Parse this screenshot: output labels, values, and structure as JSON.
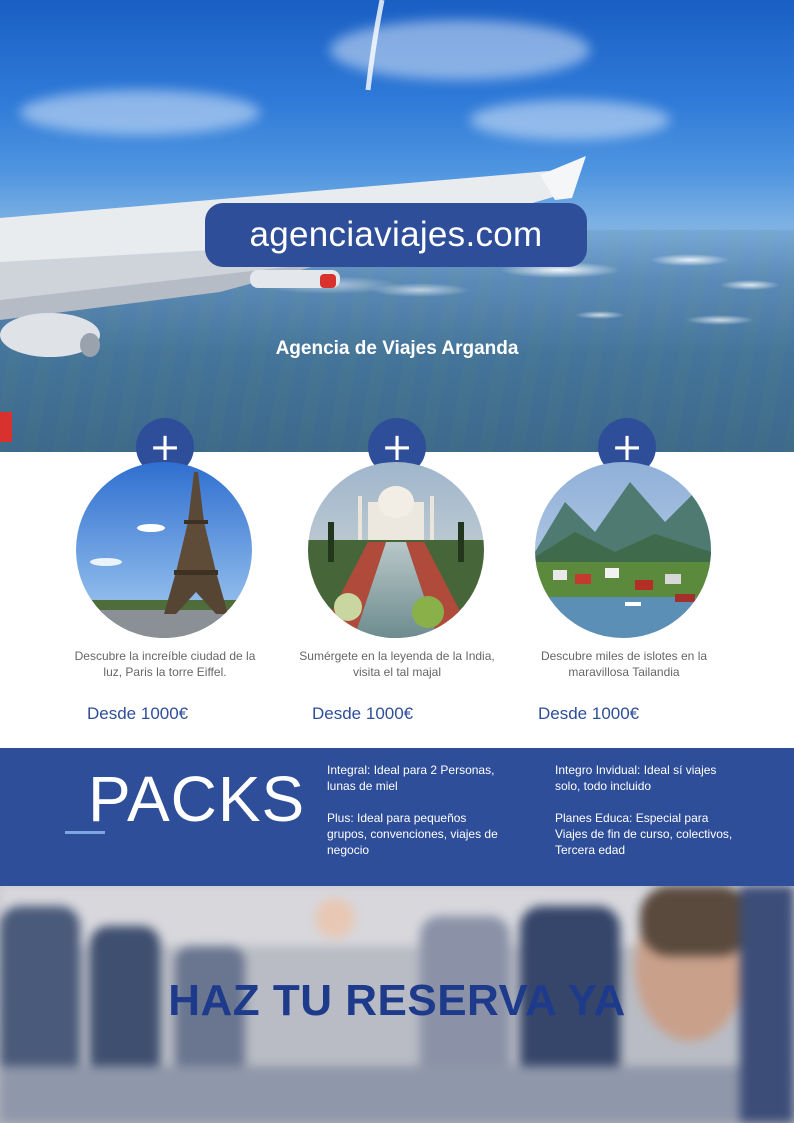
{
  "hero": {
    "brand": "agenciaviajes.com",
    "tagline": "Agencia de Viajes Arganda"
  },
  "destinations": [
    {
      "plus": "+",
      "description": "Descubre la increíble ciudad de la luz, Paris la torre Eiffel.",
      "price": "Desde 1000€",
      "icon": "eiffel-tower-photo"
    },
    {
      "plus": "+",
      "description": "Sumérgete en la leyenda de la India, visita el tal majal",
      "price": "Desde 1000€",
      "icon": "taj-mahal-photo"
    },
    {
      "plus": "+",
      "description": "Descubre miles de islotes en la maravillosa Tailandia",
      "price": "Desde 1000€",
      "icon": "islands-photo"
    }
  ],
  "packs": {
    "title": "PACKS",
    "items": [
      "Integral: Ideal para 2 Personas, lunas de miel",
      "Plus: Ideal para pequeños grupos, convenciones, viajes de negocio",
      "Integro Invidual: Ideal sí viajes solo, todo incluido",
      "Planes Educa: Especial para Viajes de fin de curso, colectivos, Tercera edad"
    ]
  },
  "cta": {
    "label": "HAZ TU RESERVA YA"
  },
  "colors": {
    "accent": "#2e4e99",
    "cta_text": "#1e3a8a",
    "description_text": "#666666"
  }
}
